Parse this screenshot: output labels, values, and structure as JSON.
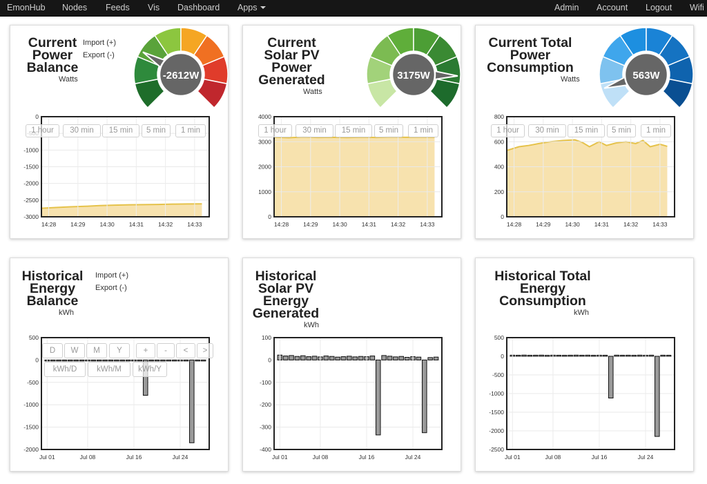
{
  "nav": {
    "left": [
      "EmonHub",
      "Nodes",
      "Feeds",
      "Vis",
      "Dashboard",
      "Apps"
    ],
    "right": [
      "Admin",
      "Account",
      "Logout",
      "Wifi"
    ]
  },
  "legend": {
    "import": "Import (+)",
    "export": "Export (-)"
  },
  "time_buttons": [
    "1 hour",
    "30 min",
    "15 min",
    "5 min",
    "1 min"
  ],
  "hist_buttons": [
    "D",
    "W",
    "M",
    "Y",
    "+",
    "-",
    "<",
    ">",
    "kWh/D",
    "kWh/M",
    "kWh/Y"
  ],
  "panels": [
    {
      "title_lines": [
        "Current",
        "Power",
        "Balance"
      ],
      "unit": "Watts",
      "gauge": {
        "value_text": "-2612W",
        "palette": [
          "#1e6d2a",
          "#2e8a3c",
          "#5aa33a",
          "#8cc63f",
          "#f5a623",
          "#f07022",
          "#e03c2b",
          "#c0272d"
        ],
        "level": 0.28
      }
    },
    {
      "title_lines": [
        "Current",
        "Solar PV",
        "Power",
        "Generated"
      ],
      "unit": "Watts",
      "gauge": {
        "value_text": "3175W",
        "palette": [
          "#c8e6a5",
          "#a2d27a",
          "#7cbb52",
          "#5fae3a",
          "#4c9e35",
          "#3a8a33",
          "#2a7a32",
          "#1d6b2c"
        ],
        "level": 0.84
      }
    },
    {
      "title_lines": [
        "Current Total",
        "Power",
        "Consumption"
      ],
      "unit": "Watts",
      "gauge": {
        "value_text": "563W",
        "palette": [
          "#bfe0f7",
          "#7ec2ef",
          "#3fa6ec",
          "#1d8fe0",
          "#1a83d6",
          "#1573c2",
          "#0f63ae",
          "#0a4f92"
        ],
        "level": 0.1
      }
    },
    {
      "title_lines": [
        "Historical",
        "Energy",
        "Balance"
      ],
      "unit": "kWh"
    },
    {
      "title_lines": [
        "Historical",
        "Solar PV",
        "Energy",
        "Generated"
      ],
      "unit": "kWh"
    },
    {
      "title_lines": [
        "Historical Total",
        "Energy",
        "Consumption"
      ],
      "unit": "kWh"
    }
  ],
  "chart_data": [
    {
      "type": "area",
      "title": "Current Power Balance",
      "x": [
        "14:27:45",
        "14:28:15",
        "14:28:45",
        "14:29:15",
        "14:29:45",
        "14:30:15",
        "14:30:45",
        "14:31:15",
        "14:31:45",
        "14:32:15",
        "14:32:45",
        "14:33:15"
      ],
      "y": [
        -2745,
        -2720,
        -2700,
        -2685,
        -2665,
        -2650,
        -2640,
        -2635,
        -2630,
        -2620,
        -2615,
        -2612
      ],
      "xticks": [
        "14:28",
        "14:29",
        "14:30",
        "14:31",
        "14:32",
        "14:33"
      ],
      "yticks": [
        "0",
        "-500",
        "-1000",
        "-1500",
        "-2000",
        "-2500",
        "-3000"
      ],
      "ylim": [
        -3000,
        0
      ],
      "grid": true
    },
    {
      "type": "area",
      "title": "Current Solar PV Power Generated",
      "x": [
        "14:27:45",
        "14:28:15",
        "14:28:45",
        "14:29:15",
        "14:29:45",
        "14:30:15",
        "14:30:45",
        "14:31:15",
        "14:31:45",
        "14:32:15",
        "14:32:45",
        "14:33:15"
      ],
      "y": [
        3180,
        3160,
        3185,
        3170,
        3175,
        3165,
        3180,
        3170,
        3185,
        3175,
        3180,
        3175
      ],
      "xticks": [
        "14:28",
        "14:29",
        "14:30",
        "14:31",
        "14:32",
        "14:33"
      ],
      "yticks": [
        "0",
        "1000",
        "2000",
        "3000",
        "4000"
      ],
      "ylim": [
        0,
        4000
      ],
      "grid": true
    },
    {
      "type": "area",
      "title": "Current Total Power Consumption",
      "x": [
        "14:27:45",
        "14:28:10",
        "14:28:30",
        "14:28:50",
        "14:29:15",
        "14:29:40",
        "14:30:05",
        "14:30:20",
        "14:30:35",
        "14:30:55",
        "14:31:10",
        "14:31:30",
        "14:31:50",
        "14:32:10",
        "14:32:25",
        "14:32:40",
        "14:33:00",
        "14:33:15"
      ],
      "y": [
        530,
        560,
        570,
        585,
        600,
        610,
        615,
        595,
        560,
        600,
        570,
        590,
        600,
        585,
        610,
        560,
        580,
        563
      ],
      "xticks": [
        "14:28",
        "14:29",
        "14:30",
        "14:31",
        "14:32",
        "14:33"
      ],
      "yticks": [
        "0",
        "200",
        "400",
        "600",
        "800"
      ],
      "ylim": [
        0,
        800
      ],
      "grid": true
    },
    {
      "type": "bar",
      "title": "Historical Energy Balance",
      "ylabel": "kWh",
      "categories": [
        "Jul 01",
        "Jul 02",
        "Jul 03",
        "Jul 04",
        "Jul 05",
        "Jul 06",
        "Jul 07",
        "Jul 08",
        "Jul 09",
        "Jul 10",
        "Jul 11",
        "Jul 12",
        "Jul 13",
        "Jul 14",
        "Jul 15",
        "Jul 16",
        "Jul 17",
        "Jul 18",
        "Jul 19",
        "Jul 20",
        "Jul 21",
        "Jul 22",
        "Jul 23",
        "Jul 24",
        "Jul 25",
        "Jul 26",
        "Jul 27",
        "Jul 28"
      ],
      "values": [
        -6,
        -9,
        -5,
        -8,
        -7,
        -10,
        -6,
        -8,
        -7,
        -9,
        -10,
        -6,
        -8,
        -7,
        -5,
        -9,
        -6,
        -790,
        -8,
        -7,
        -6,
        -9,
        -7,
        -8,
        -6,
        -1850,
        -8,
        -7
      ],
      "xticks": [
        "Jul 01",
        "Jul 08",
        "Jul 16",
        "Jul 24"
      ],
      "yticks": [
        "500",
        "0",
        "-500",
        "-1000",
        "-1500",
        "-2000"
      ],
      "ylim": [
        -2000,
        500
      ]
    },
    {
      "type": "bar",
      "title": "Historical Solar PV Energy Generated",
      "ylabel": "kWh",
      "categories": [
        "Jul 01",
        "Jul 02",
        "Jul 03",
        "Jul 04",
        "Jul 05",
        "Jul 06",
        "Jul 07",
        "Jul 08",
        "Jul 09",
        "Jul 10",
        "Jul 11",
        "Jul 12",
        "Jul 13",
        "Jul 14",
        "Jul 15",
        "Jul 16",
        "Jul 17",
        "Jul 18",
        "Jul 19",
        "Jul 20",
        "Jul 21",
        "Jul 22",
        "Jul 23",
        "Jul 24",
        "Jul 25",
        "Jul 26",
        "Jul 27",
        "Jul 28"
      ],
      "values": [
        22,
        18,
        20,
        16,
        19,
        15,
        17,
        14,
        18,
        16,
        13,
        15,
        17,
        14,
        16,
        15,
        18,
        -335,
        20,
        17,
        14,
        16,
        12,
        15,
        13,
        -325,
        11,
        13
      ],
      "xticks": [
        "Jul 01",
        "Jul 08",
        "Jul 16",
        "Jul 24"
      ],
      "yticks": [
        "100",
        "0",
        "-100",
        "-200",
        "-300",
        "-400"
      ],
      "ylim": [
        -400,
        100
      ]
    },
    {
      "type": "bar",
      "title": "Historical Total Energy Consumption",
      "ylabel": "kWh",
      "categories": [
        "Jul 01",
        "Jul 02",
        "Jul 03",
        "Jul 04",
        "Jul 05",
        "Jul 06",
        "Jul 07",
        "Jul 08",
        "Jul 09",
        "Jul 10",
        "Jul 11",
        "Jul 12",
        "Jul 13",
        "Jul 14",
        "Jul 15",
        "Jul 16",
        "Jul 17",
        "Jul 18",
        "Jul 19",
        "Jul 20",
        "Jul 21",
        "Jul 22",
        "Jul 23",
        "Jul 24",
        "Jul 25",
        "Jul 26",
        "Jul 27",
        "Jul 28"
      ],
      "values": [
        30,
        28,
        32,
        27,
        29,
        31,
        26,
        30,
        28,
        27,
        29,
        31,
        28,
        30,
        27,
        29,
        28,
        -1120,
        30,
        28,
        29,
        27,
        31,
        28,
        30,
        -2150,
        29,
        28
      ],
      "xticks": [
        "Jul 01",
        "Jul 08",
        "Jul 16",
        "Jul 24"
      ],
      "yticks": [
        "500",
        "0",
        "-500",
        "-1000",
        "-1500",
        "-2000",
        "-2500"
      ],
      "ylim": [
        -2500,
        500
      ]
    }
  ]
}
